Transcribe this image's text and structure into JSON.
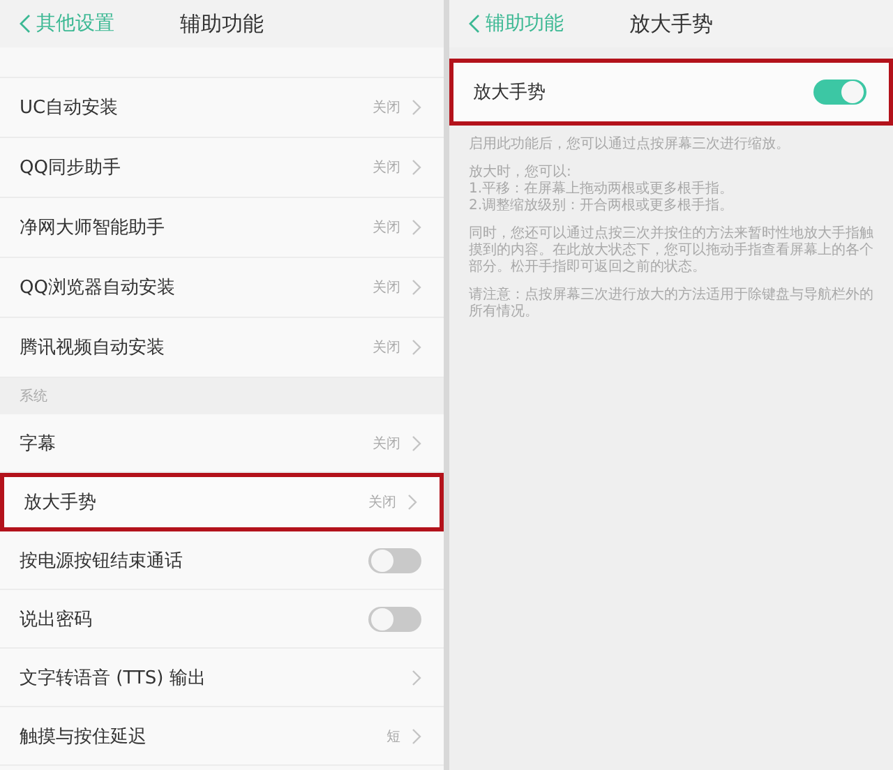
{
  "left_screen": {
    "back": "其他设置",
    "title": "辅助功能",
    "sections": [
      {
        "items": [
          {
            "label": "UC自动安装",
            "kind": "link",
            "value": "关闭",
            "highlighted": false
          },
          {
            "label": "QQ同步助手",
            "kind": "link",
            "value": "关闭",
            "highlighted": false
          },
          {
            "label": "净网大师智能助手",
            "kind": "link",
            "value": "关闭",
            "highlighted": false
          },
          {
            "label": "QQ浏览器自动安装",
            "kind": "link",
            "value": "关闭",
            "highlighted": false
          },
          {
            "label": "腾讯视频自动安装",
            "kind": "link",
            "value": "关闭",
            "highlighted": false
          }
        ]
      },
      {
        "header": "系统",
        "items": [
          {
            "label": "字幕",
            "kind": "link",
            "value": "关闭",
            "highlighted": false
          },
          {
            "label": "放大手势",
            "kind": "link",
            "value": "关闭",
            "highlighted": true
          },
          {
            "label": "按电源按钮结束通话",
            "kind": "toggle",
            "on": false,
            "highlighted": false
          },
          {
            "label": "说出密码",
            "kind": "toggle",
            "on": false,
            "highlighted": false
          },
          {
            "label": "文字转语音 (TTS) 输出",
            "kind": "link",
            "highlighted": false
          },
          {
            "label": "触摸与按住延迟",
            "kind": "link",
            "value": "短",
            "highlighted": false
          }
        ]
      }
    ]
  },
  "right_screen": {
    "back": "辅助功能",
    "title": "放大手势",
    "setting": {
      "label": "放大手势",
      "on": true,
      "highlighted": true
    },
    "paragraphs": [
      [
        "启用此功能后，您可以通过点按屏幕三次进行缩放。"
      ],
      [
        "放大时，您可以:",
        "1.平移：在屏幕上拖动两根或更多根手指。",
        "2.调整缩放级别：开合两根或更多根手指。"
      ],
      [
        "同时，您还可以通过点按三次并按住的方法来暂时性地放大手指触摸到的内容。在此放大状态下，您可以拖动手指查看屏幕上的各个部分。松开手指即可返回之前的状态。"
      ],
      [
        "请注意：点按屏幕三次进行放大的方法适用于除键盘与导航栏外的所有情况。"
      ]
    ]
  }
}
